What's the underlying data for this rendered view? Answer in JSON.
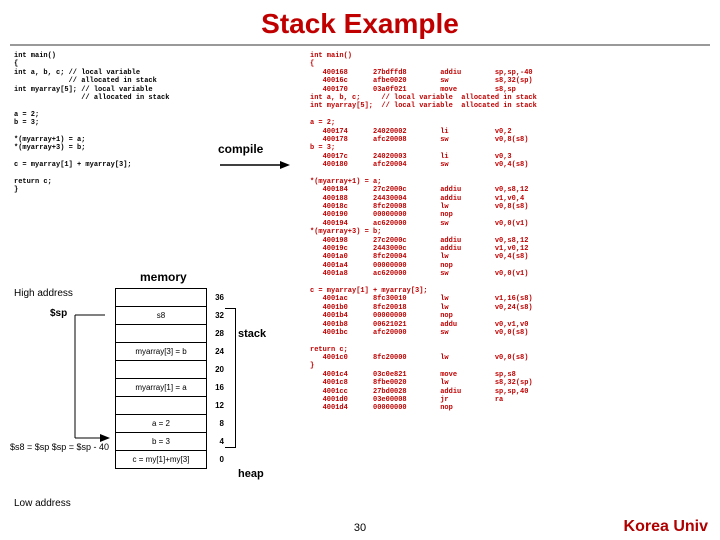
{
  "title": "Stack Example",
  "pageNum": "30",
  "footer": "Korea Univ",
  "labels": {
    "compile": "compile",
    "memory": "memory",
    "highAddr": "High address",
    "lowAddr": "Low address",
    "sp": "$sp",
    "stack": "stack",
    "heap": "heap",
    "spEq": "$s8 = $sp   $sp = $sp - 40"
  },
  "codeLeft": "int main()\n{\nint a, b, c; // local variable\n             // allocated in stack\nint myarray[5]; // local variable\n                // allocated in stack\n\na = 2;\nb = 3;\n\n*(myarray+1) = a;\n*(myarray+3) = b;\n\nc = myarray[1] + myarray[3];\n\nreturn c;\n}",
  "codeRight": "int main()\n{\n   400168      27bdffd8        addiu        sp,sp,-40\n   40016c      afbe0020        sw           s8,32(sp)\n   400170      03a0f021        move         s8,sp\nint a, b, c;     // local variable  allocated in stack\nint myarray[5];  // local variable  allocated in stack\n\na = 2;\n   400174      24020002        li           v0,2\n   400178      afc20008        sw           v0,8(s8)\nb = 3;\n   40017c      24020003        li           v0,3\n   400180      afc20004        sw           v0,4(s8)\n\n*(myarray+1) = a;\n   400184      27c2000c        addiu        v0,s8,12\n   400188      24430004        addiu        v1,v0,4\n   40018c      8fc20008        lw           v0,8(s8)\n   400190      00000000        nop\n   400194      ac620000        sw           v0,0(v1)\n*(myarray+3) = b;\n   400198      27c2000c        addiu        v0,s8,12\n   40019c      2443000c        addiu        v1,v0,12\n   4001a0      8fc20004        lw           v0,4(s8)\n   4001a4      00000000        nop\n   4001a8      ac620000        sw           v0,0(v1)\n\nc = myarray[1] + myarray[3];\n   4001ac      8fc30010        lw           v1,16(s8)\n   4001b0      8fc20018        lw           v0,24(s8)\n   4001b4      00000000        nop\n   4001b8      00621021        addu         v0,v1,v0\n   4001bc      afc20000        sw           v0,0(s8)\n\nreturn c;\n   4001c0      8fc20000        lw           v0,0(s8)\n}\n   4001c4      03c0e821        move         sp,s8\n   4001c8      8fbe0020        lw           s8,32(sp)\n   4001cc      27bd0028        addiu        sp,sp,40\n   4001d0      03e00008        jr           ra\n   4001d4      00000000        nop",
  "memRows": [
    {
      "label": "",
      "offset": "36"
    },
    {
      "label": "s8",
      "offset": "32"
    },
    {
      "label": "",
      "offset": "28"
    },
    {
      "label": "myarray[3] = b",
      "offset": "24"
    },
    {
      "label": "",
      "offset": "20"
    },
    {
      "label": "myarray[1] = a",
      "offset": "16"
    },
    {
      "label": "",
      "offset": "12"
    },
    {
      "label": "a = 2",
      "offset": "8"
    },
    {
      "label": "b = 3",
      "offset": "4"
    },
    {
      "label": "c = my[1]+my[3]",
      "offset": "0"
    }
  ]
}
